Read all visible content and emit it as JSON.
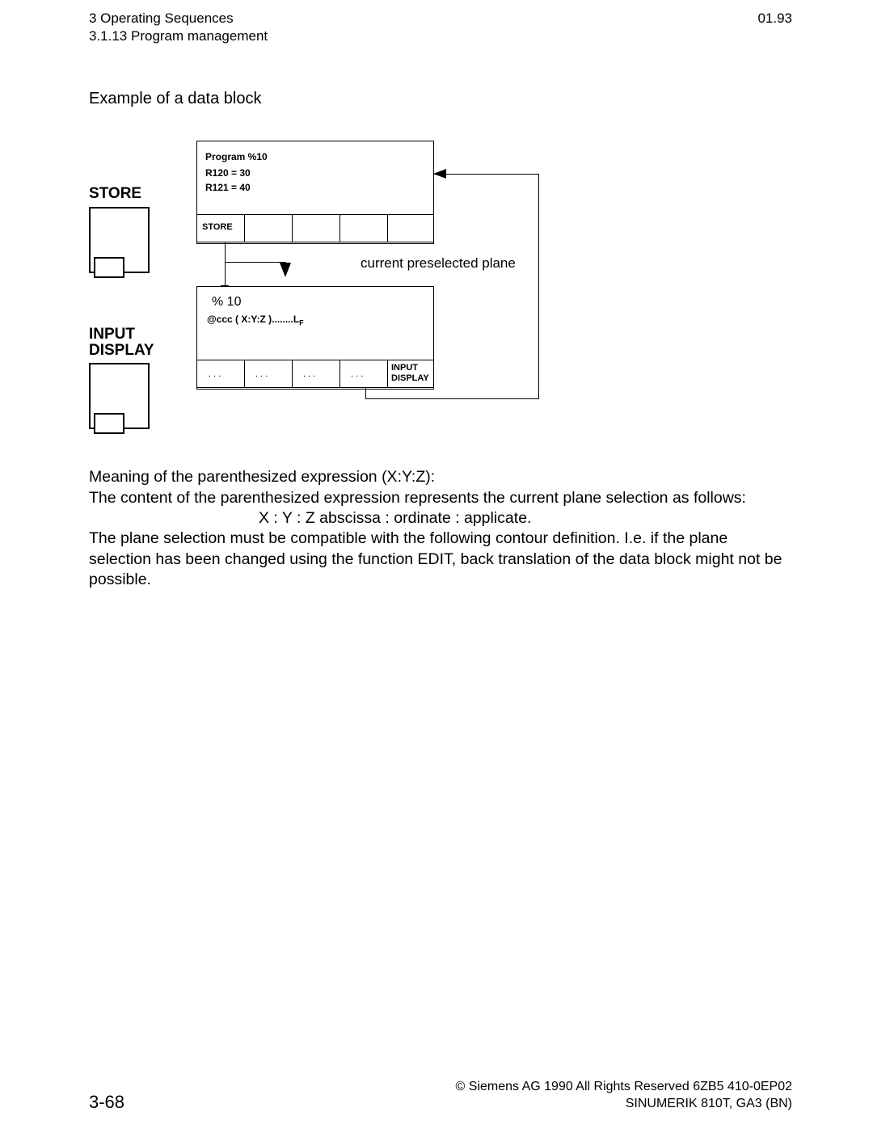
{
  "header": {
    "chapter": "3  Operating Sequences",
    "section": "3.1.13  Program management",
    "version": "01.93"
  },
  "title": "Example of a data block",
  "diagram": {
    "store_label": "STORE",
    "input_display_label_1": "INPUT",
    "input_display_label_2": "DISPLAY",
    "prog_box": {
      "line1": "Program %10",
      "line2": "R120 = 30",
      "line3": "R121 = 40",
      "store_key": "STORE"
    },
    "current_preselected": "current preselected plane",
    "second_box": {
      "line1": "% 10",
      "line2_a": "@ccc ( X:Y:Z )........L",
      "line2_sub": "F",
      "dots": ". . .",
      "input_display_1": "INPUT",
      "input_display_2": "DISPLAY"
    }
  },
  "body": {
    "p1": "Meaning of the parenthesized expression (X:Y:Z):",
    "p2": "The content of the parenthesized expression represents the current plane selection as follows:",
    "p3": "X : Y : Z    abscissa : ordinate : applicate.",
    "p4": "The plane selection must be compatible with the following contour definition. I.e. if the plane selection has been changed using the function EDIT, back translation of the data block might not be possible."
  },
  "footer": {
    "page": "3-68",
    "copyright": "© Siemens AG 1990 All Rights Reserved     6ZB5 410-0EP02",
    "product": "SINUMERIK 810T, GA3 (BN)"
  }
}
